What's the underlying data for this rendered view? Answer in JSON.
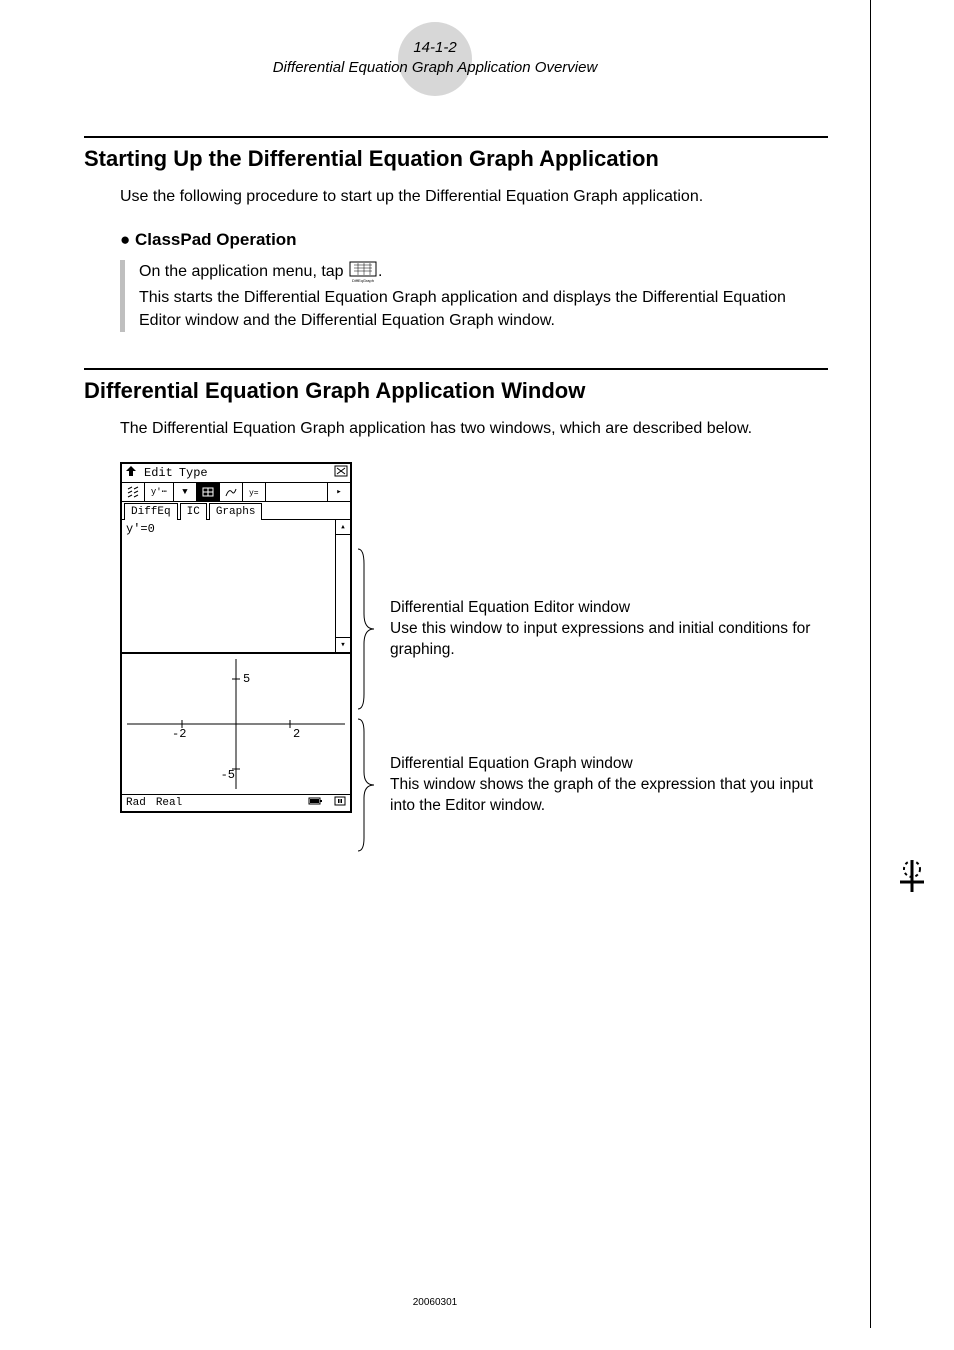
{
  "header": {
    "section_number": "14-1-2",
    "section_title": "Differential Equation Graph Application Overview"
  },
  "section1": {
    "heading": "Starting Up the Differential Equation Graph Application",
    "intro": "Use the following procedure to start up the Differential Equation Graph application.",
    "sub_heading": "ClassPad Operation",
    "step1_pre": "On the application menu, tap ",
    "step1_post": ".",
    "step2": "This starts the Differential Equation Graph application and displays the Differential Equation Editor window and the Differential Equation Graph window."
  },
  "section2": {
    "heading": "Differential Equation Graph Application Window",
    "intro": "The Differential Equation Graph application has two windows, which are described below."
  },
  "device": {
    "menu": {
      "edit": "Edit",
      "type": "Type"
    },
    "tabs": {
      "diffeq": "DiffEq",
      "ic": "IC",
      "graphs": "Graphs"
    },
    "editor_line": "y'=0",
    "status": {
      "rad": "Rad",
      "real": "Real"
    },
    "graph_ticks": {
      "y_pos": "5",
      "y_neg": "-5",
      "x_pos": "2",
      "x_neg": "-2"
    }
  },
  "annotations": {
    "editor_title": "Differential Equation Editor window",
    "editor_body": "Use this window to input expressions and initial conditions for graphing.",
    "graph_title": "Differential Equation Graph window",
    "graph_body": "This window shows the graph of the expression that you input into the Editor window."
  },
  "footer": {
    "date": "20060301"
  }
}
